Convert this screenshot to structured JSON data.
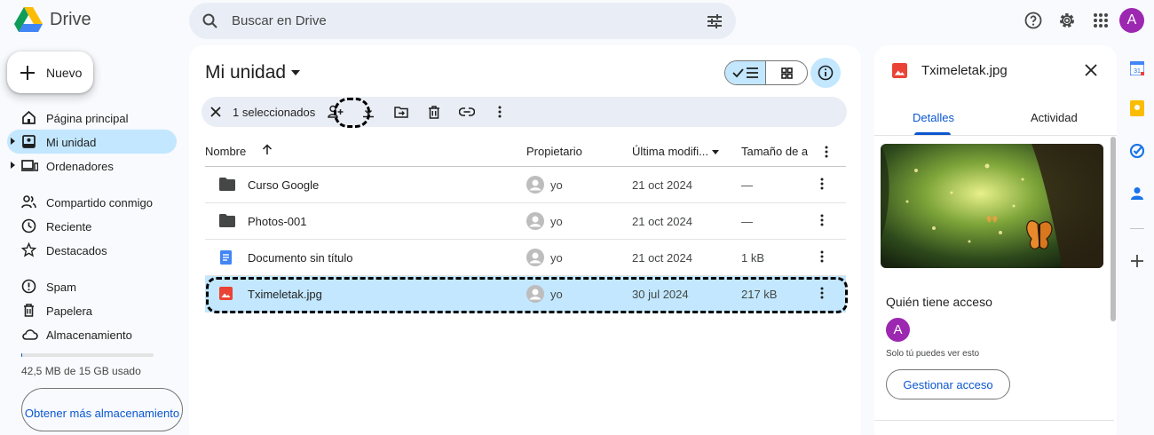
{
  "app": {
    "name": "Drive"
  },
  "search": {
    "placeholder": "Buscar en Drive"
  },
  "top_actions": [
    "help-icon",
    "settings-icon",
    "apps-grid-icon"
  ],
  "user": {
    "avatar_letter": "A",
    "avatar_color": "#9c27b0"
  },
  "new_button": {
    "label": "Nuevo"
  },
  "nav": {
    "items": [
      {
        "label": "Página principal",
        "icon": "home-icon"
      },
      {
        "label": "Mi unidad",
        "icon": "my-drive-icon",
        "active": true
      },
      {
        "label": "Ordenadores",
        "icon": "computers-icon"
      },
      {
        "label": "Compartido conmigo",
        "icon": "shared-icon"
      },
      {
        "label": "Reciente",
        "icon": "clock-icon"
      },
      {
        "label": "Destacados",
        "icon": "star-icon"
      },
      {
        "label": "Spam",
        "icon": "spam-icon"
      },
      {
        "label": "Papelera",
        "icon": "trash-icon"
      },
      {
        "label": "Almacenamiento",
        "icon": "cloud-icon"
      }
    ]
  },
  "storage": {
    "used_text": "42,5 MB de 15 GB usado",
    "used_fraction": 0.003,
    "button_label": "Obtener más almacenamiento"
  },
  "main": {
    "title": "Mi unidad",
    "selection_text": "1 seleccionados",
    "columns": {
      "name": "Nombre",
      "owner": "Propietario",
      "modified": "Última modifi...",
      "size": "Tamaño de a"
    },
    "files": [
      {
        "name": "Curso Google",
        "type": "folder",
        "owner": "yo",
        "modified": "21 oct 2024",
        "size": "—"
      },
      {
        "name": "Photos-001",
        "type": "folder",
        "owner": "yo",
        "modified": "21 oct 2024",
        "size": "—"
      },
      {
        "name": "Documento sin título",
        "type": "doc",
        "owner": "yo",
        "modified": "21 oct 2024",
        "size": "1 kB"
      },
      {
        "name": "Tximeletak.jpg",
        "type": "image",
        "owner": "yo",
        "modified": "30 jul 2024",
        "size": "217 kB",
        "selected": true
      }
    ]
  },
  "details": {
    "file_name": "Tximeletak.jpg",
    "tabs": [
      "Detalles",
      "Actividad"
    ],
    "access_title": "Quién tiene acceso",
    "access_note": "Solo tú puedes ver esto",
    "manage_button": "Gestionar acceso"
  },
  "colors": {
    "accent": "#0b57d0",
    "selected_bg": "#c2e7ff",
    "search_bg": "#e9eef6",
    "page_bg": "#f8fafd"
  }
}
